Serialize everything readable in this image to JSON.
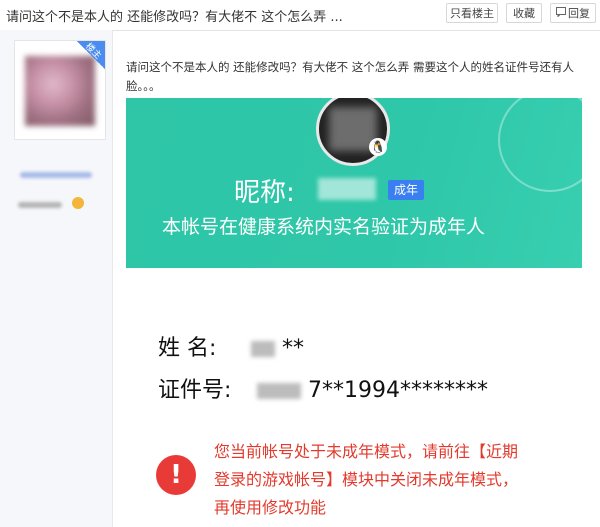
{
  "header": {
    "thread_title": "请问这个不是本人的 还能修改吗？有大佬不 这个怎么弄 ...",
    "buttons": {
      "only_op": "只看楼主",
      "favorite": "收藏",
      "reply": "回复"
    }
  },
  "sidebar": {
    "corner_tag": "楼主"
  },
  "post": {
    "text": "请问这个不是本人的 还能修改吗？有大佬不 这个怎么弄 需要这个人的姓名证件号还有人脸。。。",
    "screenshot": {
      "nickname_label": "昵称:",
      "adult_tag": "成年",
      "verify_text": "本帐号在健康系统内实名验证为成年人"
    },
    "id_info": {
      "name_label": "姓    名:",
      "name_value": "**",
      "id_label": "证件号:",
      "id_value": "7**1994********"
    },
    "warning": {
      "text": "您当前帐号处于未成年模式，请前往【近期登录的游戏帐号】模块中关闭未成年模式，再使用修改功能",
      "icon": "!"
    }
  },
  "colors": {
    "banner": "#2ec6a7",
    "warning": "#e23b2e",
    "tag": "#3a7ff0"
  }
}
